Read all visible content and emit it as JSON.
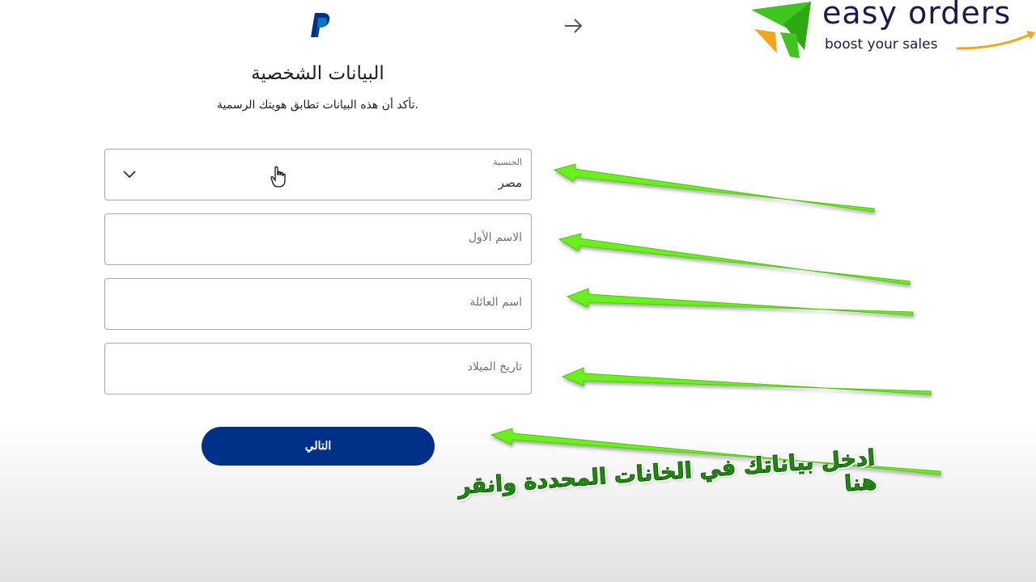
{
  "header": {
    "logo_icon": "paypal-logo",
    "arrow_icon": "arrow-right-icon"
  },
  "brand": {
    "name": "easy orders",
    "tagline": "boost your sales",
    "colors": {
      "green": "#3fc51f",
      "orange": "#f3a61b",
      "navy": "#1b1a4a"
    }
  },
  "page": {
    "title": "البيانات الشخصية",
    "subtitle": "تأكد أن هذه البيانات تطابق هويتك الرسمية."
  },
  "form": {
    "nationality": {
      "label": "الجنسية",
      "value": "مصر",
      "icon": "chevron-down-icon"
    },
    "first_name": {
      "placeholder": "الاسم الأول"
    },
    "last_name": {
      "placeholder": "اسم العائلة"
    },
    "birthdate": {
      "placeholder": "تاريخ الميلاد"
    },
    "next_label": "التالي"
  },
  "annotation": {
    "instruction": "ادخل بياناتك في الخانات المحددة وانقر هنا",
    "arrow_color": "#6bf01a"
  },
  "colors": {
    "button": "#003087",
    "border": "#a9a9a9"
  }
}
